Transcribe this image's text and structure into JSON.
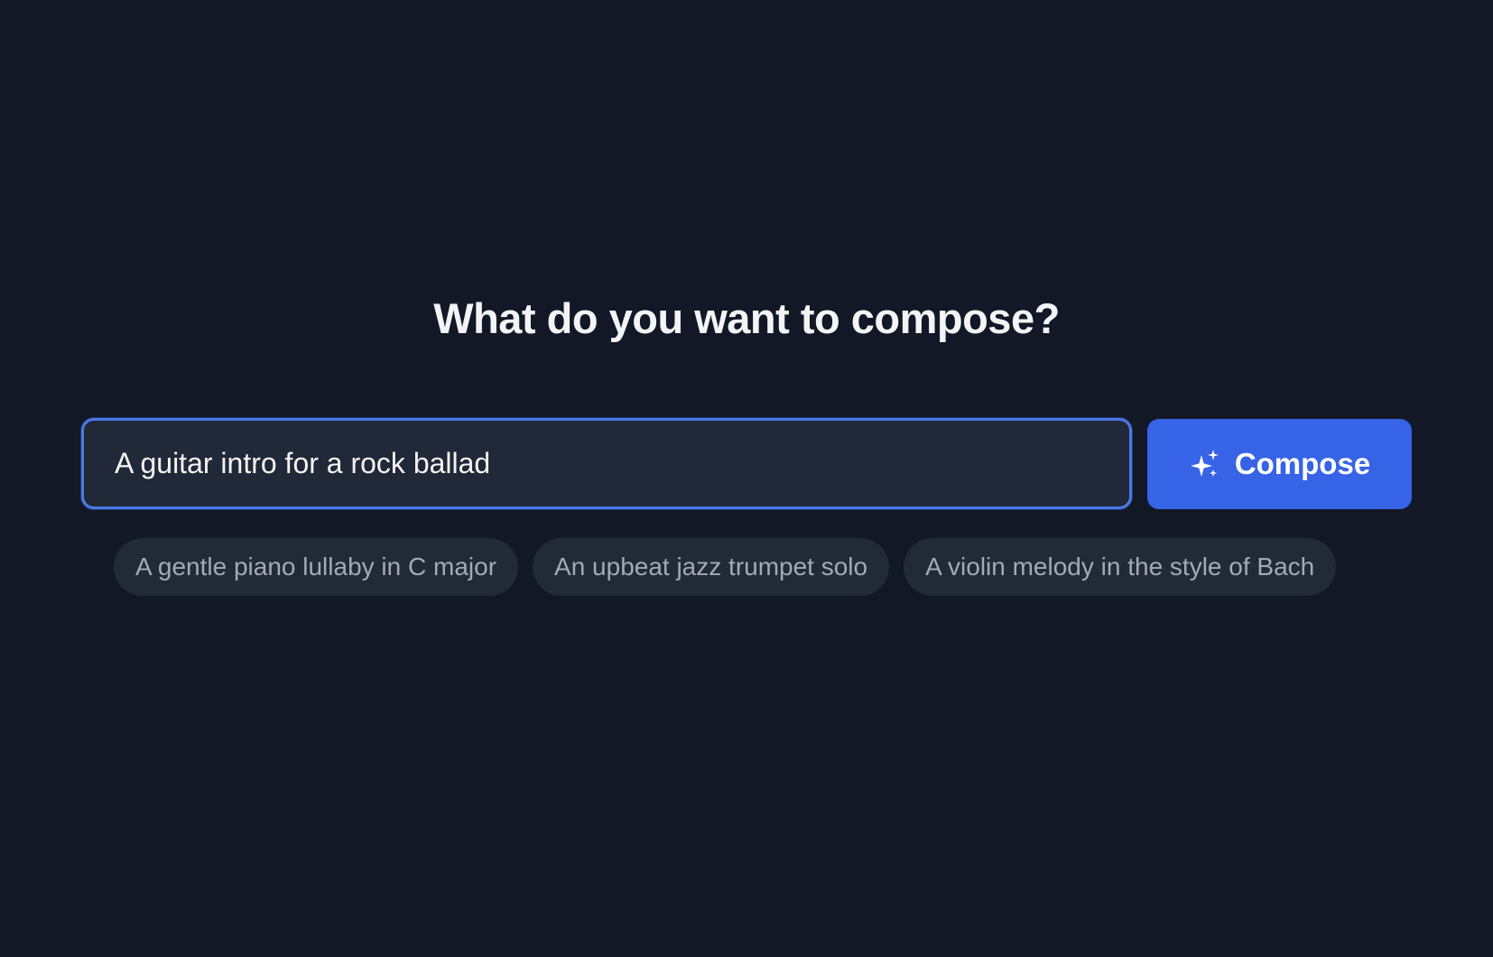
{
  "page": {
    "title": "What do you want to compose?"
  },
  "prompt": {
    "value": "A guitar intro for a rock ballad",
    "compose_label": "Compose",
    "compose_icon": "sparkles-icon"
  },
  "suggestions": [
    {
      "label": "A gentle piano lullaby in C major"
    },
    {
      "label": "An upbeat jazz trumpet solo"
    },
    {
      "label": "A violin melody in the style of Bach"
    }
  ],
  "colors": {
    "background": "#121826",
    "accent": "#3763e6",
    "input_border": "#4a7ae6",
    "chip_background": "#222937",
    "chip_text": "#a3a9b5"
  }
}
